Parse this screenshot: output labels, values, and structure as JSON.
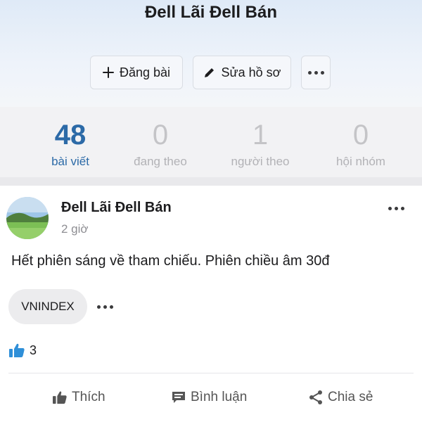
{
  "profile": {
    "name": "Đell Lãi Đell Bán",
    "actions": {
      "post_label": "Đăng bài",
      "edit_label": "Sửa hồ sơ",
      "more_icon": "more-horizontal-icon"
    }
  },
  "stats": [
    {
      "value": "48",
      "label": "bài viết",
      "active": true
    },
    {
      "value": "0",
      "label": "đang theo",
      "active": false
    },
    {
      "value": "1",
      "label": "người theo",
      "active": false
    },
    {
      "value": "0",
      "label": "hội nhóm",
      "active": false
    }
  ],
  "post": {
    "author": "Đell Lãi Đell Bán",
    "time": "2 giờ",
    "text": "Hết phiên sáng về tham chiếu. Phiên chiều âm 30đ",
    "tag": "VNINDEX",
    "likes": "3"
  },
  "footer": {
    "like_label": "Thích",
    "comment_label": "Bình luận",
    "share_label": "Chia sẻ"
  },
  "colors": {
    "accent": "#2c6aa7",
    "like_blue": "#2f8fd8",
    "muted": "#b2b2b6"
  }
}
